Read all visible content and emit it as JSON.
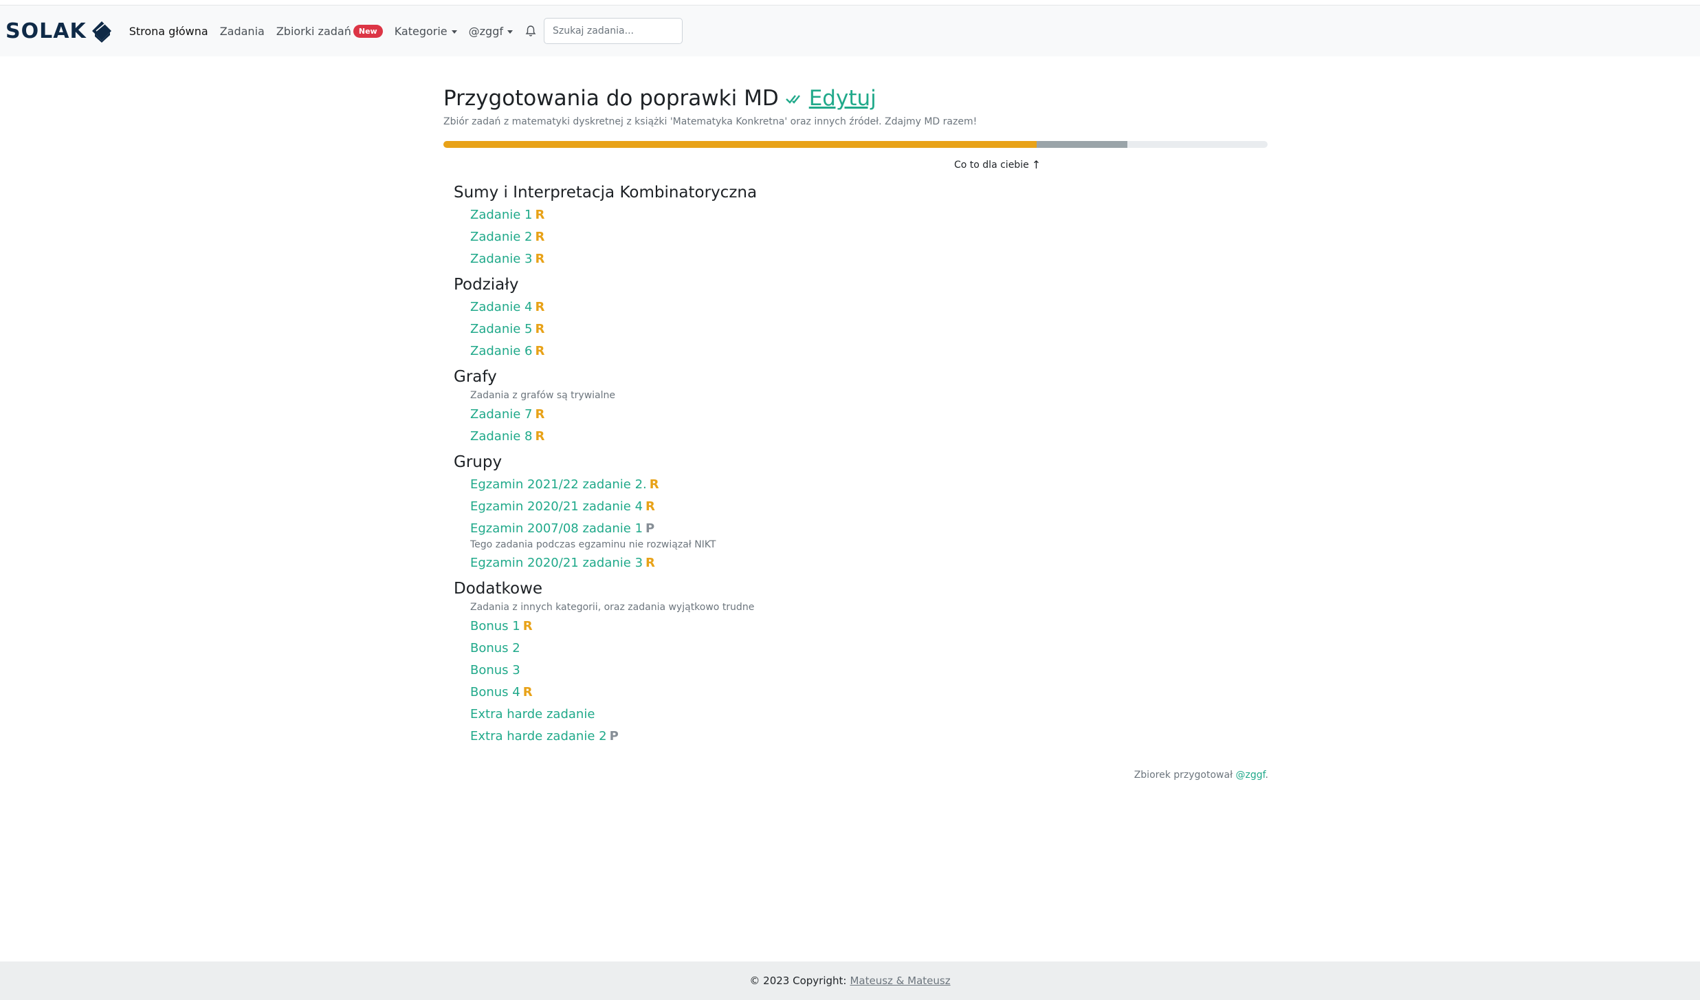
{
  "navbar": {
    "brand": "SOLAK",
    "links": [
      "Strona główna",
      "Zadania",
      "Zbiorki zadań"
    ],
    "new_badge": "New",
    "categories": "Kategorie",
    "user": "@zggf",
    "search_placeholder": "Szukaj zadania..."
  },
  "collection": {
    "title": "Przygotowania do poprawki MD",
    "edit_label": "Edytuj",
    "description": "Zbiór zadań z matematyki dyskretnej z książki 'Matematyka Konkretna' oraz innych źródeł. Zdajmy MD razem!",
    "progress": {
      "solved_fraction": 0.72,
      "attempted_fraction": 0.11
    },
    "progress_label": "Co to dla ciebie",
    "author_prefix": "Zbiorek przygotował",
    "author": "@zggf",
    "author_suffix": "."
  },
  "sections": [
    {
      "title": "Sumy i Interpretacja Kombinatoryczna",
      "description": "",
      "tasks": [
        {
          "name": "Zadanie 1",
          "status": "R",
          "note": ""
        },
        {
          "name": "Zadanie 2",
          "status": "R",
          "note": ""
        },
        {
          "name": "Zadanie 3",
          "status": "R",
          "note": ""
        }
      ]
    },
    {
      "title": "Podziały",
      "description": "",
      "tasks": [
        {
          "name": "Zadanie 4",
          "status": "R",
          "note": ""
        },
        {
          "name": "Zadanie 5",
          "status": "R",
          "note": ""
        },
        {
          "name": "Zadanie 6",
          "status": "R",
          "note": ""
        }
      ]
    },
    {
      "title": "Grafy",
      "description": "Zadania z grafów są trywialne",
      "tasks": [
        {
          "name": "Zadanie 7",
          "status": "R",
          "note": ""
        },
        {
          "name": "Zadanie 8",
          "status": "R",
          "note": ""
        }
      ]
    },
    {
      "title": "Grupy",
      "description": "",
      "tasks": [
        {
          "name": "Egzamin 2021/22 zadanie 2.",
          "status": "R",
          "note": ""
        },
        {
          "name": "Egzamin 2020/21 zadanie 4",
          "status": "R",
          "note": ""
        },
        {
          "name": "Egzamin 2007/08 zadanie 1",
          "status": "P",
          "note": "Tego zadania podczas egzaminu nie rozwiązał NIKT"
        },
        {
          "name": "Egzamin 2020/21 zadanie 3",
          "status": "R",
          "note": ""
        }
      ]
    },
    {
      "title": "Dodatkowe",
      "description": "Zadania z innych kategorii, oraz zadania wyjątkowo trudne",
      "tasks": [
        {
          "name": "Bonus 1",
          "status": "R",
          "note": ""
        },
        {
          "name": "Bonus 2",
          "status": "",
          "note": ""
        },
        {
          "name": "Bonus 3",
          "status": "",
          "note": ""
        },
        {
          "name": "Bonus 4",
          "status": "R",
          "note": ""
        },
        {
          "name": "Extra harde zadanie",
          "status": "",
          "note": ""
        },
        {
          "name": "Extra harde zadanie 2",
          "status": "P",
          "note": ""
        }
      ]
    }
  ],
  "footer": {
    "copyright": "© 2023 Copyright:",
    "authors": "Mateusz & Mateusz"
  },
  "colors": {
    "accent": "#20a98a",
    "solved": "#e8a218",
    "pending": "#868e96",
    "badge": "#dc3545"
  }
}
